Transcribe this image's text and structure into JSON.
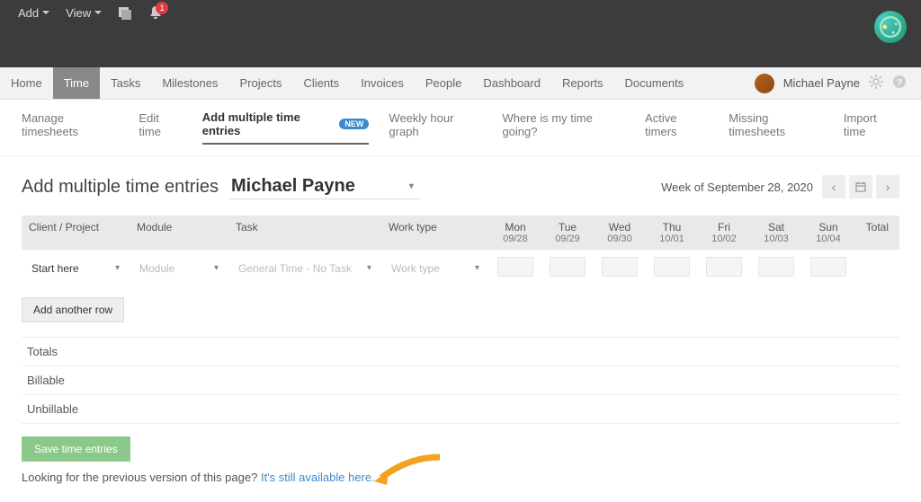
{
  "topbar": {
    "add": "Add",
    "view": "View",
    "notification_count": "1"
  },
  "mainnav": {
    "items": [
      "Home",
      "Time",
      "Tasks",
      "Milestones",
      "Projects",
      "Clients",
      "Invoices",
      "People",
      "Dashboard",
      "Reports",
      "Documents"
    ],
    "active": "Time",
    "user": "Michael Payne"
  },
  "subnav": {
    "items": [
      {
        "label": "Manage timesheets"
      },
      {
        "label": "Edit time"
      },
      {
        "label": "Add multiple time entries",
        "active": true,
        "badge": "NEW"
      },
      {
        "label": "Weekly hour graph"
      },
      {
        "label": "Where is my time going?"
      },
      {
        "label": "Active timers"
      },
      {
        "label": "Missing timesheets"
      },
      {
        "label": "Import time"
      }
    ]
  },
  "page": {
    "title": "Add multiple time entries",
    "person": "Michael Payne",
    "week_label": "Week of September 28, 2020"
  },
  "columns": {
    "client": "Client / Project",
    "module": "Module",
    "task": "Task",
    "worktype": "Work type",
    "total": "Total",
    "days": [
      {
        "name": "Mon",
        "date": "09/28"
      },
      {
        "name": "Tue",
        "date": "09/29"
      },
      {
        "name": "Wed",
        "date": "09/30"
      },
      {
        "name": "Thu",
        "date": "10/01"
      },
      {
        "name": "Fri",
        "date": "10/02"
      },
      {
        "name": "Sat",
        "date": "10/03"
      },
      {
        "name": "Sun",
        "date": "10/04"
      }
    ]
  },
  "row": {
    "client": "Start here",
    "module_placeholder": "Module",
    "task": "General Time - No Task",
    "worktype_placeholder": "Work type"
  },
  "add_row": "Add another row",
  "summary": {
    "totals": "Totals",
    "billable": "Billable",
    "unbillable": "Unbillable"
  },
  "save": "Save time entries",
  "prev_note": {
    "text": "Looking for the previous version of this page? ",
    "link": "It's still available here."
  }
}
